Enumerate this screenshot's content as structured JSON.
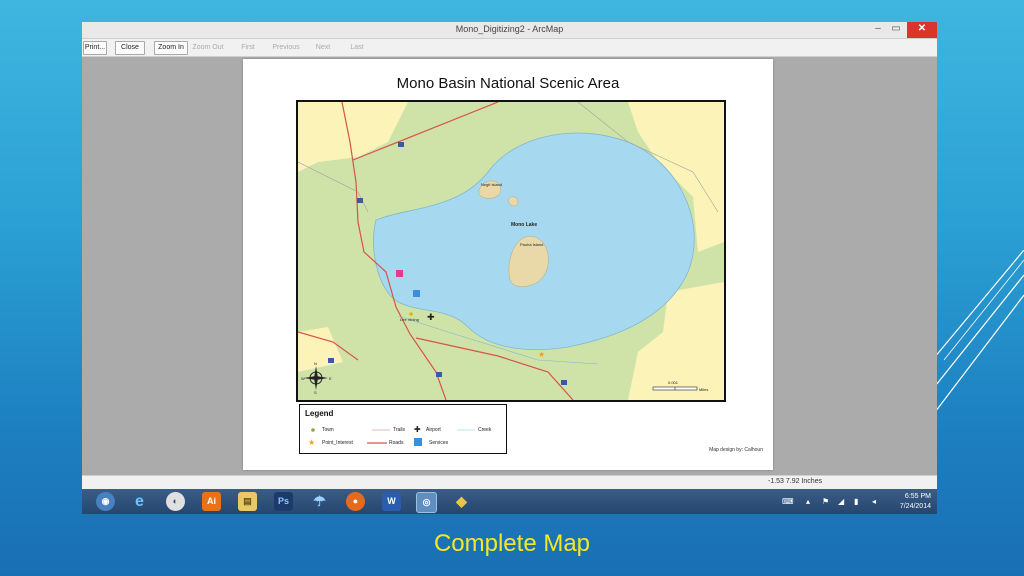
{
  "window": {
    "title": "Mono_Digitizing2 - ArcMap",
    "minimize": "–",
    "maximize": "▭",
    "close": "✕"
  },
  "toolbar": {
    "print": "Print...",
    "close": "Close",
    "zoom_in": "Zoom In",
    "zoom_out": "Zoom Out",
    "first": "First",
    "previous": "Previous",
    "next": "Next",
    "last": "Last"
  },
  "map": {
    "title": "Mono Basin National Scenic Area",
    "labels": {
      "negit_island": "Negit Island",
      "mono_lake": "Mono Lake",
      "paoha_island": "Paoha Island",
      "lee_vining": "Lee Vining",
      "scale": "0.001",
      "scale_unit": "Miles",
      "north_n": "N",
      "north_w": "W",
      "north_e": "E",
      "north_s": "S"
    },
    "legend": {
      "title": "Legend",
      "town": "Town",
      "trails": "Trails",
      "airport": "Airport",
      "creek": "Creek",
      "point_interest": "Point_Interest",
      "roads": "Roads",
      "services": "Services"
    },
    "credit": "Map design by: Calhoun"
  },
  "status": {
    "coords": "-1.53  7.92 Inches"
  },
  "taskbar": {
    "clock_time": "6:55 PM",
    "clock_date": "7/24/2014"
  },
  "caption": "Complete Map",
  "colors": {
    "lake": "#a6d9ef",
    "land": "#cfe3a9",
    "forest": "#fbf3b8",
    "road": "#d7534a",
    "caption": "#f4e825"
  }
}
